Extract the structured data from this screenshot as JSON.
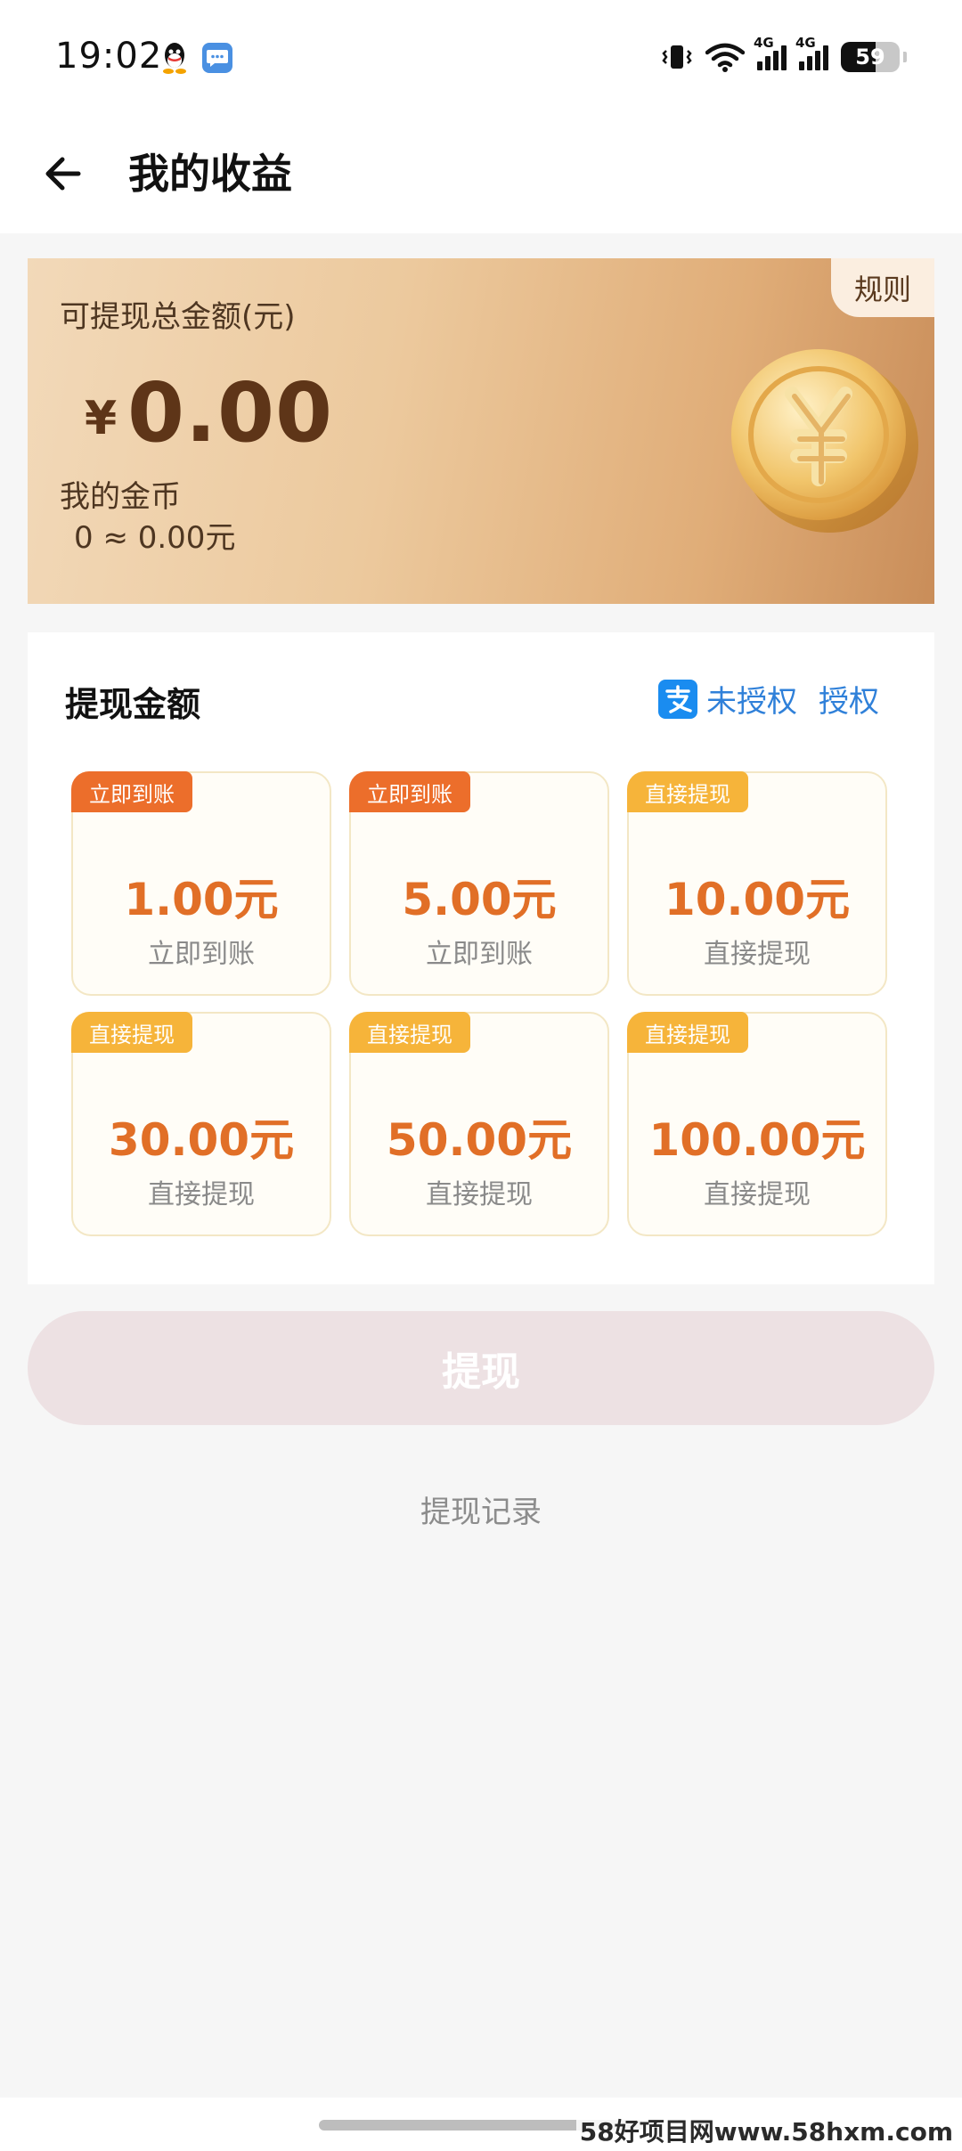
{
  "status_bar": {
    "time": "19:02",
    "left_icons": [
      "qq-icon",
      "message-icon"
    ],
    "right_icons": [
      "vibrate-icon",
      "wifi-icon",
      "signal-4g-icon",
      "signal-4g-icon",
      "battery-icon"
    ],
    "network_label_1": "4G",
    "network_label_2": "4G",
    "battery_level": "59"
  },
  "header": {
    "back_icon": "arrow-left-icon",
    "title": "我的收益"
  },
  "balance_card": {
    "rules_label": "规则",
    "total_label": "可提现总金额(元)",
    "currency_symbol": "¥",
    "total_amount": "0.00",
    "coins_label": "我的金币",
    "coins_value": "0 ≈ 0.00元",
    "coin_icon": "gold-yuan-coin-icon",
    "colors": {
      "card_start": "#f2d9b9",
      "card_end": "#c98d59",
      "amount_text": "#5e3518"
    }
  },
  "withdraw_panel": {
    "title": "提现金额",
    "alipay_icon": "alipay-icon",
    "alipay_status": "未授权",
    "authorize_label": "授权",
    "options": [
      {
        "badge": "立即到账",
        "badge_color": "#ec6e2b",
        "amount": "1.00元",
        "desc": "立即到账"
      },
      {
        "badge": "立即到账",
        "badge_color": "#ec6e2b",
        "amount": "5.00元",
        "desc": "立即到账"
      },
      {
        "badge": "直接提现",
        "badge_color": "#f6b43a",
        "amount": "10.00元",
        "desc": "直接提现"
      },
      {
        "badge": "直接提现",
        "badge_color": "#f6b43a",
        "amount": "30.00元",
        "desc": "直接提现"
      },
      {
        "badge": "直接提现",
        "badge_color": "#f6b43a",
        "amount": "50.00元",
        "desc": "直接提现"
      },
      {
        "badge": "直接提现",
        "badge_color": "#f6b43a",
        "amount": "100.00元",
        "desc": "直接提现"
      }
    ]
  },
  "withdraw_button": {
    "label": "提现",
    "enabled": false
  },
  "history_link": "提现记录",
  "watermark": "58好项目网www.58hxm.com"
}
